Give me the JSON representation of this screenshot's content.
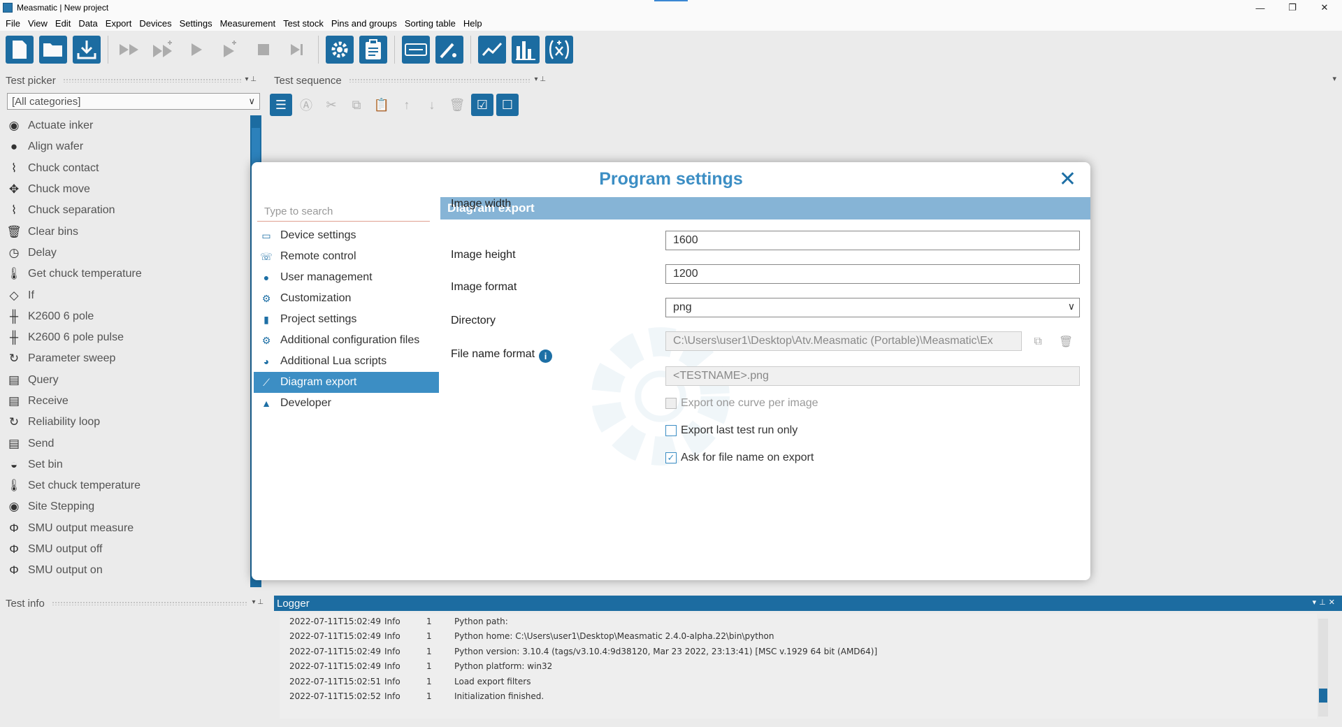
{
  "window": {
    "title": "Measmatic | New project",
    "controls": [
      "—",
      "❐",
      "✕"
    ]
  },
  "menu": [
    "File",
    "View",
    "Edit",
    "Data",
    "Export",
    "Devices",
    "Settings",
    "Measurement",
    "Test stock",
    "Pins and groups",
    "Sorting table",
    "Help"
  ],
  "toolbar_icons": [
    "new-file-icon",
    "open-folder-icon",
    "download-icon",
    "fast-forward-icon",
    "step-forward-plus-icon",
    "play-icon",
    "play-plus-icon",
    "stop-icon",
    "skip-end-icon",
    "gear-icon",
    "clipboard-icon",
    "device-icon",
    "probe-icon",
    "line-chart-icon",
    "bar-chart-icon",
    "function-icon"
  ],
  "accent_color": "#1d6fa5",
  "test_picker": {
    "title": "Test picker",
    "category": "[All categories]",
    "items": [
      {
        "label": "Actuate inker",
        "icon": "◉"
      },
      {
        "label": "Align wafer",
        "icon": "●"
      },
      {
        "label": "Chuck contact",
        "icon": "⌇"
      },
      {
        "label": "Chuck move",
        "icon": "✥"
      },
      {
        "label": "Chuck separation",
        "icon": "⌇"
      },
      {
        "label": "Clear bins",
        "icon": "🗑"
      },
      {
        "label": "Delay",
        "icon": "◷"
      },
      {
        "label": "Get chuck temperature",
        "icon": "🌡"
      },
      {
        "label": "If",
        "icon": "◇"
      },
      {
        "label": "K2600 6 pole",
        "icon": "╫"
      },
      {
        "label": "K2600 6 pole pulse",
        "icon": "╫"
      },
      {
        "label": "Parameter sweep",
        "icon": "↻"
      },
      {
        "label": "Query",
        "icon": "▤"
      },
      {
        "label": "Receive",
        "icon": "▤"
      },
      {
        "label": "Reliability loop",
        "icon": "↻"
      },
      {
        "label": "Send",
        "icon": "▤"
      },
      {
        "label": "Set bin",
        "icon": "◒"
      },
      {
        "label": "Set chuck temperature",
        "icon": "🌡"
      },
      {
        "label": "Site Stepping",
        "icon": "◉"
      },
      {
        "label": "SMU output measure",
        "icon": "Φ"
      },
      {
        "label": "SMU output off",
        "icon": "Φ"
      },
      {
        "label": "SMU output on",
        "icon": "Φ"
      }
    ]
  },
  "test_sequence": {
    "title": "Test sequence"
  },
  "test_info": {
    "title": "Test info"
  },
  "logger": {
    "title": "Logger",
    "rows": [
      {
        "time": "2022-07-11T15:02:49",
        "level": "Info",
        "num": "1",
        "msg": "Python path:"
      },
      {
        "time": "2022-07-11T15:02:49",
        "level": "Info",
        "num": "1",
        "msg": "Python home: C:\\Users\\user1\\Desktop\\Measmatic 2.4.0-alpha.22\\bin\\python"
      },
      {
        "time": "2022-07-11T15:02:49",
        "level": "Info",
        "num": "1",
        "msg": "Python version: 3.10.4 (tags/v3.10.4:9d38120, Mar 23 2022, 23:13:41) [MSC v.1929 64 bit (AMD64)]"
      },
      {
        "time": "2022-07-11T15:02:49",
        "level": "Info",
        "num": "1",
        "msg": "Python platform: win32"
      },
      {
        "time": "2022-07-11T15:02:51",
        "level": "Info",
        "num": "1",
        "msg": "Load export filters"
      },
      {
        "time": "2022-07-11T15:02:52",
        "level": "Info",
        "num": "1",
        "msg": "Initialization finished."
      }
    ]
  },
  "dialog": {
    "title": "Program settings",
    "search_placeholder": "Type to search",
    "nav": [
      {
        "label": "Device settings",
        "icon": "device-icon"
      },
      {
        "label": "Remote control",
        "icon": "remote-icon"
      },
      {
        "label": "User management",
        "icon": "user-icon"
      },
      {
        "label": "Customization",
        "icon": "gear-icon"
      },
      {
        "label": "Project settings",
        "icon": "document-icon"
      },
      {
        "label": "Additional configuration files",
        "icon": "config-files-icon"
      },
      {
        "label": "Additional Lua scripts",
        "icon": "lua-icon"
      },
      {
        "label": "Diagram export",
        "icon": "line-chart-icon",
        "selected": true
      },
      {
        "label": "Developer",
        "icon": "android-icon"
      }
    ],
    "section": "Diagram export",
    "fields": {
      "image_width_label": "Image width",
      "image_width": "1600",
      "image_height_label": "Image height",
      "image_height": "1200",
      "image_format_label": "Image format",
      "image_format": "png",
      "directory_label": "Directory",
      "directory": "C:\\Users\\user1\\Desktop\\Atv.Measmatic (Portable)\\Measmatic\\Ex",
      "file_name_format_label": "File name format",
      "file_name_format": "<TESTNAME>.png"
    },
    "checkboxes": [
      {
        "label": "Export one curve per image",
        "checked": false,
        "disabled": true
      },
      {
        "label": "Export last test run only",
        "checked": false,
        "disabled": false
      },
      {
        "label": "Ask for file name on export",
        "checked": true,
        "disabled": false
      }
    ]
  }
}
